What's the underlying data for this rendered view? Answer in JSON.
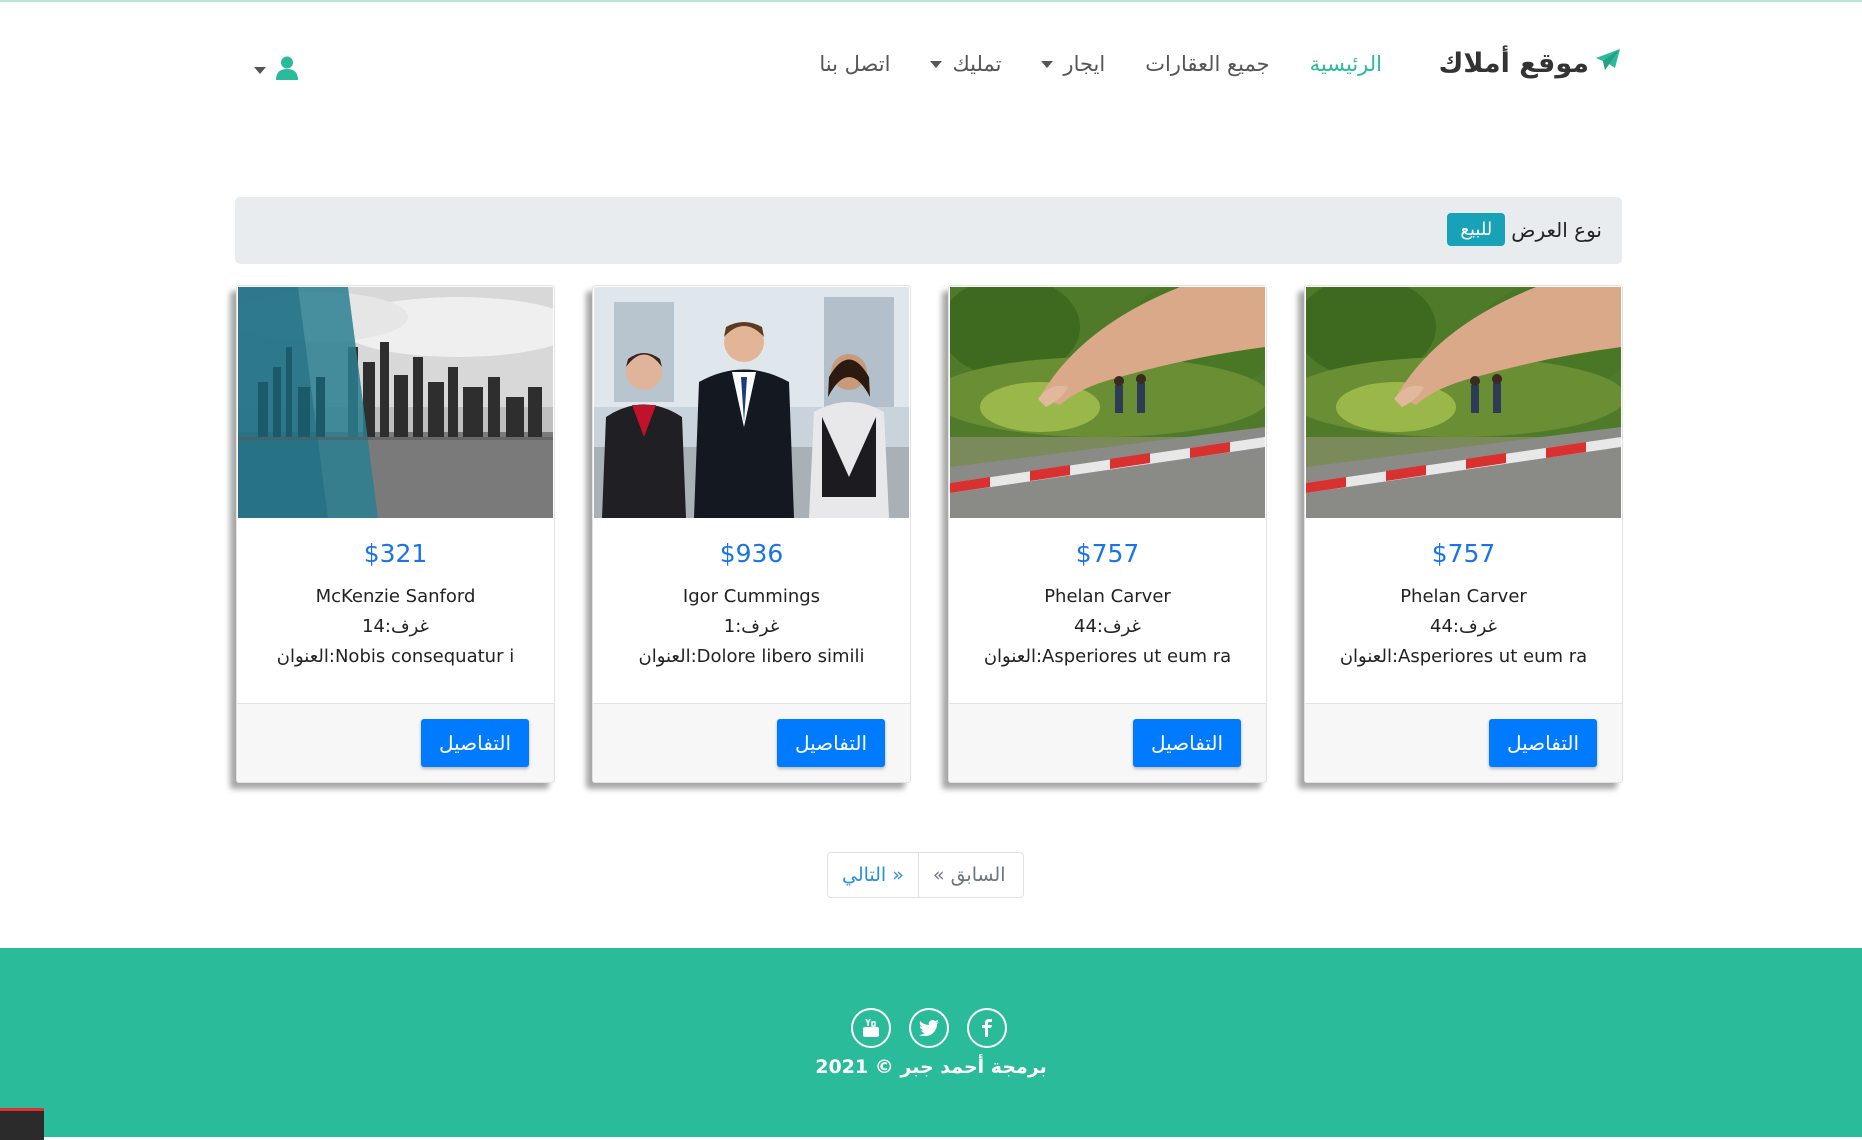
{
  "brand": {
    "name": "موقع أملاك",
    "accent": "#2abb9b"
  },
  "nav": {
    "items": [
      {
        "label": "الرئيسية",
        "active": true,
        "dropdown": false
      },
      {
        "label": "جميع العقارات",
        "active": false,
        "dropdown": false
      },
      {
        "label": "ايجار",
        "active": false,
        "dropdown": true
      },
      {
        "label": "تمليك",
        "active": false,
        "dropdown": true
      },
      {
        "label": "اتصل بنا",
        "active": false,
        "dropdown": false
      }
    ],
    "user_icon": "user-icon"
  },
  "filter": {
    "label": "نوع العرض",
    "badge": "للبيع",
    "badge_color": "#17a2b8"
  },
  "cards": [
    {
      "price": "$757",
      "name": "Phelan Carver",
      "rooms": "غرف:44",
      "address": "العنوان:Asperiores ut eum ra",
      "button": "التفاصيل",
      "image": "hand-road-photo"
    },
    {
      "price": "$757",
      "name": "Phelan Carver",
      "rooms": "غرف:44",
      "address": "العنوان:Asperiores ut eum ra",
      "button": "التفاصيل",
      "image": "hand-road-photo"
    },
    {
      "price": "$936",
      "name": "Igor Cummings",
      "rooms": "غرف:1",
      "address": "العنوان:Dolore libero simili",
      "button": "التفاصيل",
      "image": "business-people-photo"
    },
    {
      "price": "$321",
      "name": "McKenzie Sanford",
      "rooms": "غرف:14",
      "address": "العنوان:Nobis consequatur i",
      "button": "التفاصيل",
      "image": "city-skyline-photo"
    }
  ],
  "pagination": {
    "prev": "« السابق",
    "next": "التالي »"
  },
  "footer": {
    "socials": [
      "facebook-icon",
      "twitter-icon",
      "youtube-icon"
    ],
    "copyright": "برمجة أحمد جبر © 2021"
  }
}
